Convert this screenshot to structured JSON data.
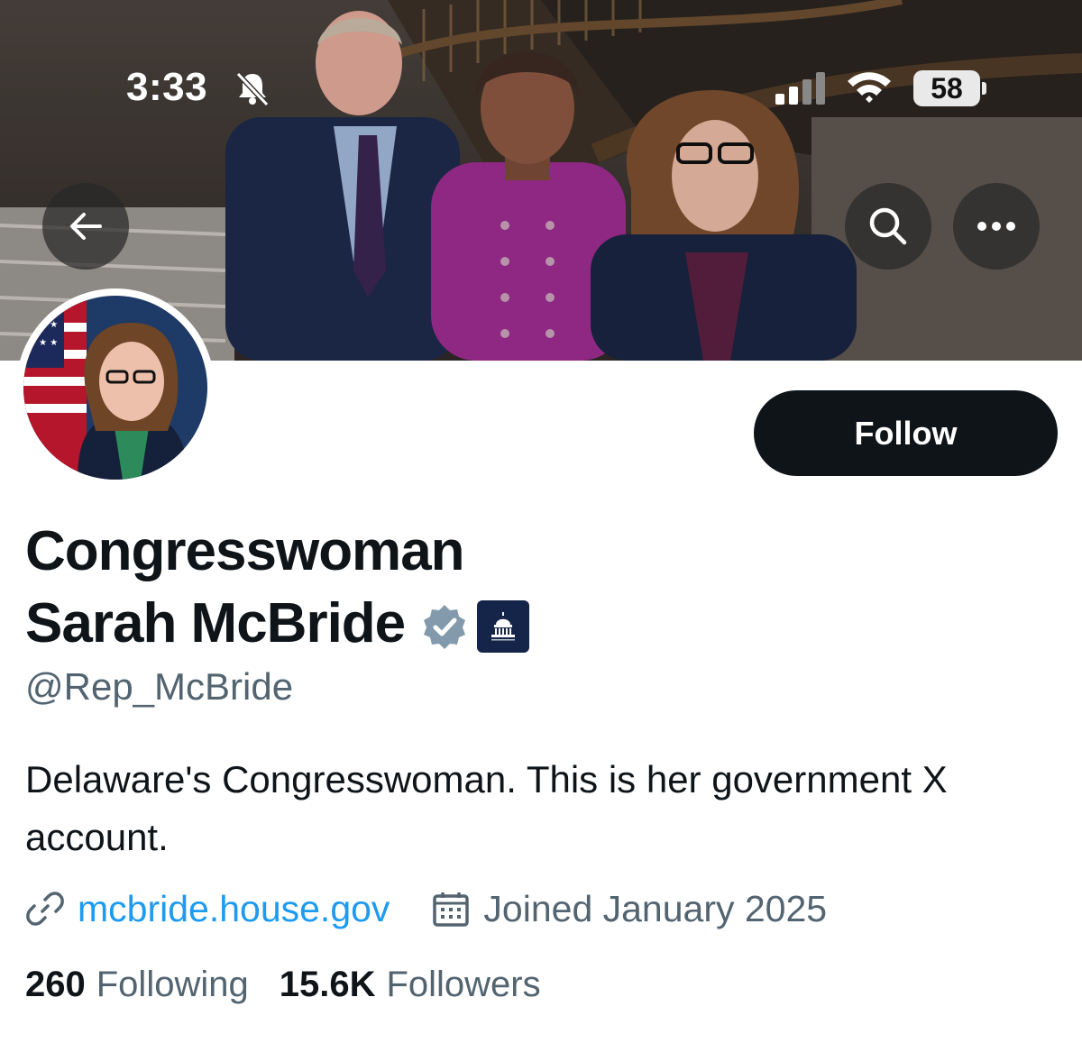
{
  "status_bar": {
    "time": "3:33",
    "battery": "58",
    "icons": [
      "bell-muted-icon",
      "cellular-signal-icon",
      "wifi-icon",
      "battery-icon"
    ]
  },
  "header": {
    "buttons": [
      "back-arrow-icon",
      "search-icon",
      "more-options-icon"
    ]
  },
  "profile": {
    "name_line1": "Congresswoman",
    "name_line2": "Sarah McBride",
    "handle": "@Rep_McBride",
    "bio": "Delaware's Congresswoman. This is her government X account.",
    "website": "mcbride.house.gov",
    "joined": "Joined January 2025",
    "following_count": "260",
    "following_label": "Following",
    "followers_count": "15.6K",
    "followers_label": "Followers",
    "follow_button": "Follow",
    "verified_badge": "grey-verified-badge-icon",
    "affiliation_badge": "house-democrats-capitol-icon"
  },
  "colors": {
    "text_primary": "#0f1419",
    "text_secondary": "#536471",
    "link": "#1d9bf0",
    "verified_grey": "#829aab",
    "follow_bg": "#0f1419"
  }
}
